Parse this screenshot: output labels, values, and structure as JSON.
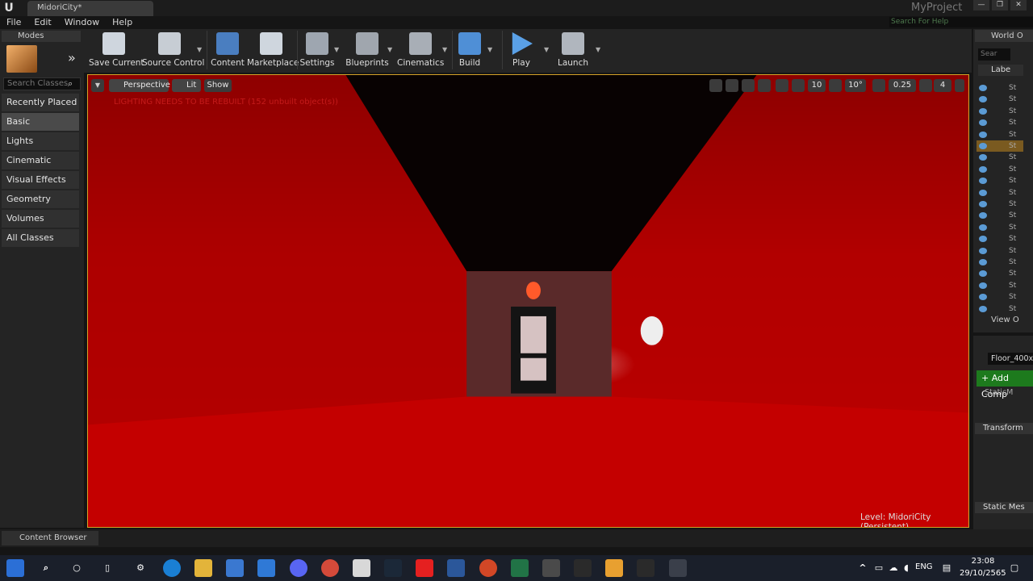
{
  "window": {
    "doc_tab": "MidoriCity*",
    "project_name": "MyProject",
    "help_search_placeholder": "Search For Help"
  },
  "menu": [
    "File",
    "Edit",
    "Window",
    "Help"
  ],
  "modes_panel": {
    "tab_label": "Modes",
    "search_placeholder": "Search Classes",
    "categories": [
      "Recently Placed",
      "Basic",
      "Lights",
      "Cinematic",
      "Visual Effects",
      "Geometry",
      "Volumes",
      "All Classes"
    ],
    "active_category": "Basic"
  },
  "toolbar": {
    "buttons": [
      {
        "label": "Save Current",
        "color": "#cfd6de"
      },
      {
        "label": "Source Control",
        "color": "#c7cdd4"
      },
      {
        "label": "Content",
        "color": "#4a7ec0"
      },
      {
        "label": "Marketplace",
        "color": "#cfd6de"
      },
      {
        "label": "Settings",
        "color": "#9ea6b0"
      },
      {
        "label": "Blueprints",
        "color": "#a0a6ae"
      },
      {
        "label": "Cinematics",
        "color": "#a8aeb6"
      },
      {
        "label": "Build",
        "color": "#4f8fd6"
      },
      {
        "label": "Play",
        "color": "#5aa0e6"
      },
      {
        "label": "Launch",
        "color": "#b0b6be"
      }
    ]
  },
  "viewport": {
    "view_mode": "Perspective",
    "lighting_mode": "Lit",
    "show_label": "Show",
    "warning": "LIGHTING NEEDS TO BE REBUILT (152 unbuilt object(s))",
    "grid_snap": "10",
    "rotation_snap": "10°",
    "scale_snap": "0.25",
    "camera_speed": "4",
    "level_label": "Level:  MidoriCity (Persistent)"
  },
  "outliner": {
    "tab_label": "World O",
    "search_placeholder": "Sear",
    "label_header": "Labe",
    "rows": [
      "St",
      "St",
      "St",
      "St",
      "St",
      "St",
      "St",
      "St",
      "St",
      "St",
      "St",
      "St",
      "St",
      "St",
      "St",
      "St",
      "St",
      "St",
      "St",
      "St"
    ],
    "selected_index": 5,
    "view_options": "View O"
  },
  "details": {
    "object_name": "Floor_400x",
    "add_component": "+ Add Comp",
    "component": "StaticM",
    "transform_header": "Transform",
    "static_mesh_header": "Static Mes"
  },
  "content_browser": {
    "tab_label": "Content Browser"
  },
  "taskbar": {
    "language": "ENG",
    "time": "23:08",
    "date": "29/10/2565"
  }
}
